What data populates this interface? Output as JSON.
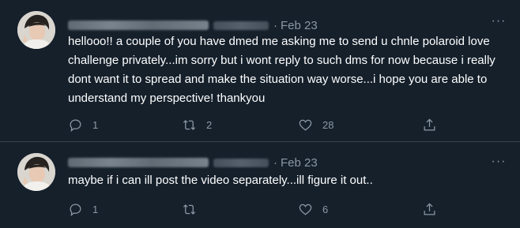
{
  "tweets": [
    {
      "date": "Feb 23",
      "dot": "·",
      "text": "hellooo!! a couple of you have dmed me asking me to send u chnle polaroid love challenge privately...im sorry but i wont reply to such dms for now because i really dont want it to spread and make the situation way worse...i hope you are able to understand my perspective! thankyou",
      "replies": "1",
      "retweets": "2",
      "likes": "28"
    },
    {
      "date": "Feb 23",
      "dot": "·",
      "text": "maybe if i can ill post the video separately...ill figure it out..",
      "replies": "1",
      "retweets": "",
      "likes": "6"
    }
  ],
  "more_glyph": "···",
  "colors": {
    "background": "#15202b",
    "text": "#ffffff",
    "muted": "#8b98a5",
    "divider": "#38444d"
  },
  "icons": [
    "reply-icon",
    "retweet-icon",
    "like-icon",
    "share-icon",
    "more-icon"
  ]
}
